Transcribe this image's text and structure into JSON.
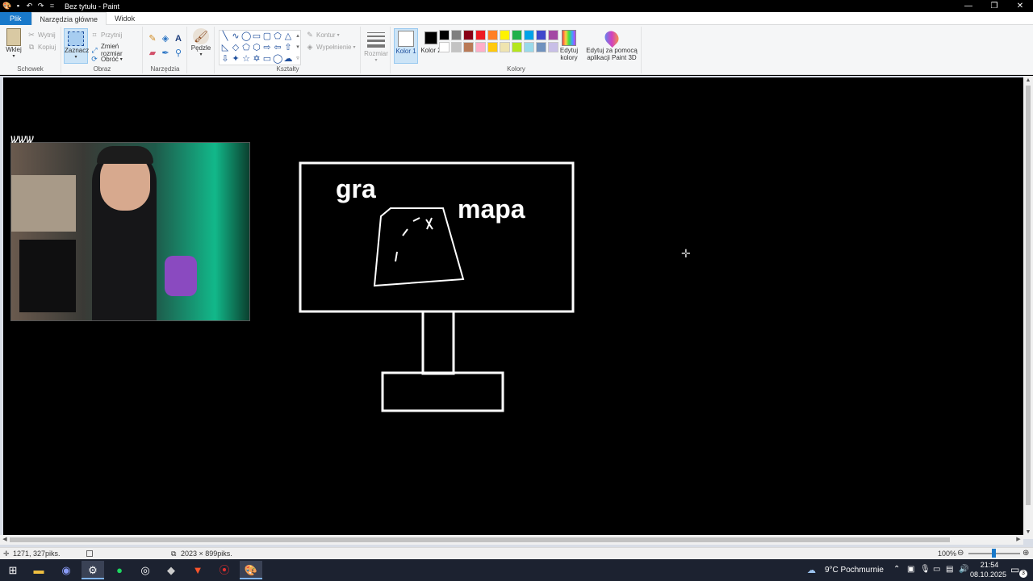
{
  "window": {
    "title": "Bez tytułu - Paint",
    "minimize": "—",
    "restore": "❐",
    "close": "✕"
  },
  "tabs": [
    "Plik",
    "Narzędzia główne",
    "Widok"
  ],
  "ribbon": {
    "clipboard": {
      "label": "Schowek",
      "paste": "Wklej",
      "cut": "Wytnij",
      "copy": "Kopiuj"
    },
    "image": {
      "label": "Obraz",
      "select": "Zaznacz",
      "crop": "Przytnij",
      "resize": "Zmień rozmiar",
      "rotate": "Obróć"
    },
    "tools": {
      "label": "Narzędzia"
    },
    "brushes": {
      "label": "Pędzle"
    },
    "shapes": {
      "label": "Kształty",
      "outline": "Kontur",
      "fill": "Wypełnienie"
    },
    "size": {
      "label": "Rozmiar"
    },
    "colors": {
      "label": "Kolory",
      "color1": "Kolor 1",
      "color2": "Kolor 2",
      "edit": "Edytuj kolory",
      "paint3d": "Edytuj za pomocą aplikacji Paint 3D",
      "row1": [
        "#000000",
        "#7f7f7f",
        "#880015",
        "#ed1c24",
        "#ff7f27",
        "#fff200",
        "#22b14c",
        "#00a2e8",
        "#3f48cc",
        "#a349a4"
      ],
      "row2": [
        "#ffffff",
        "#c3c3c3",
        "#b97a57",
        "#ffaec9",
        "#ffc90e",
        "#efe4b0",
        "#b5e61d",
        "#99d9ea",
        "#7092be",
        "#c8bfe7"
      ]
    }
  },
  "canvas": {
    "text_gra": "gra",
    "text_mapa": "mapa",
    "logo_text": "ѡѡѡ"
  },
  "status": {
    "cursor_pos": "1271, 327piks.",
    "image_size": "2023 × 899piks.",
    "zoom": "100%"
  },
  "taskbar": {
    "weather": "9°C  Pochmurnie",
    "time": "21:54",
    "date": "08.10.2025",
    "notifications": "3"
  }
}
